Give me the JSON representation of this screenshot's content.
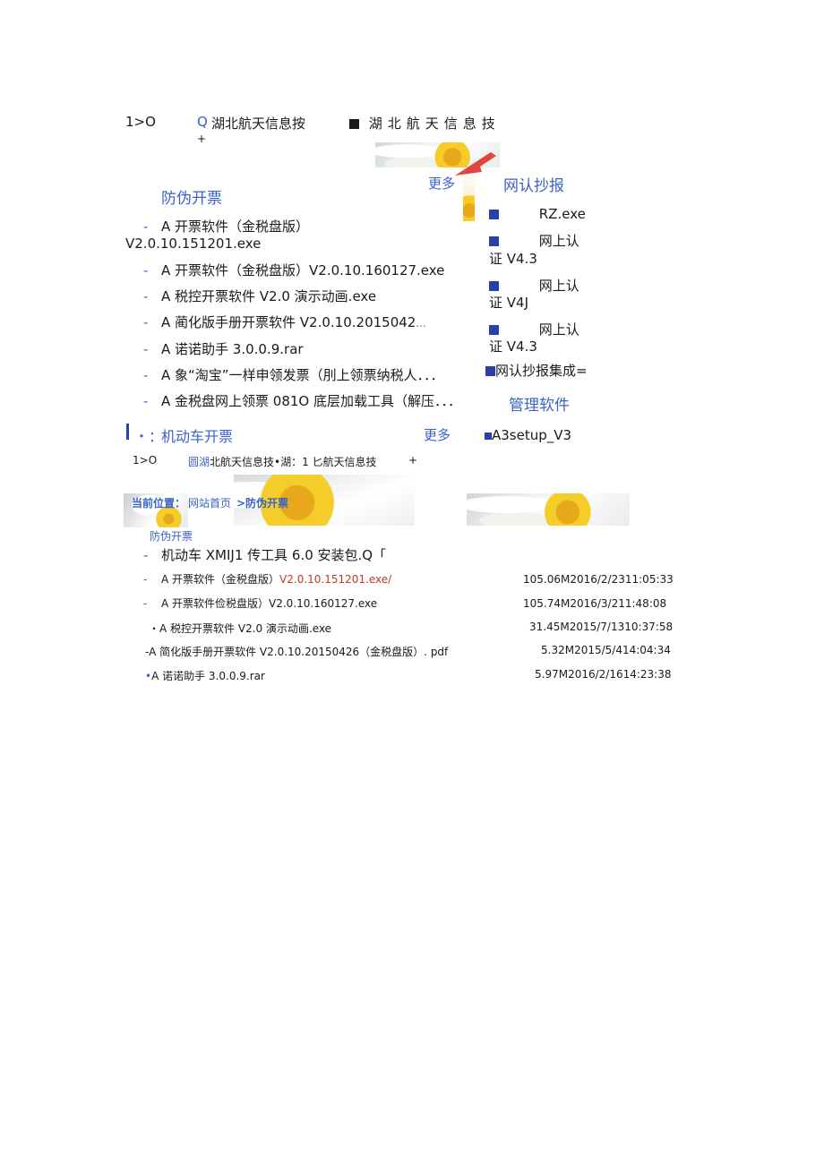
{
  "header": {
    "left_code": "1>O",
    "q_icon_text": "Q",
    "title_small": "湖北航天信息按",
    "plus": "+",
    "title_spaced": "湖北航天信息技"
  },
  "section1": {
    "title": "防伪开票",
    "more": "更多",
    "items": [
      "A 开票软件（金税盘版）",
      "V2.0.10.151201.exe",
      "A 开票软件（金税盘版）V2.0.10.160127.exe",
      "A 税控开票软件 V2.0 演示动画.exe",
      "A 蔺化版手册开票软件 V2.0.10.2015042",
      "...",
      "A 诺诺助手 3.0.0.9.rar",
      "A 象“淘宝”一样申领发票（刖上领票纳税人．．．",
      "A 金税盘网上领票 081O 底层加载工具（解压．．．"
    ],
    "dash": "-"
  },
  "sidebar": {
    "title": "网认抄报",
    "items": [
      {
        "l1": "RZ.exe",
        "l2": ""
      },
      {
        "l1": "网上认",
        "l2": "证 V4.3"
      },
      {
        "l1": "网上认",
        "l2": "证 V4J"
      },
      {
        "l1": "网上认",
        "l2": "证 V4.3"
      }
    ],
    "collection": "网认抄报集成=",
    "manage_title": "管理软件",
    "manage_item": "A3setup_V3"
  },
  "section2": {
    "prefix": "l・：",
    "title": "机动车开票",
    "more": "更多"
  },
  "breadcrumb_row": {
    "left_code": "1>O",
    "circle": "圆湖",
    "mid": "北航天信息技•湖：1 匕航天信息技",
    "plus": "+"
  },
  "location": {
    "label": "当前位置：",
    "home": "网站首页",
    "current": ">防伪开票",
    "sub": "防伪开票"
  },
  "files": {
    "first": "机动车 XMIJ1 传工具 6.0 安装包.Q「",
    "rows": [
      {
        "bullet": "-",
        "name_a": "A 开票软件（金税盘版）",
        "name_b": "V2.0.10.151201.exe/",
        "meta": "105.06M2016/2/2311:05:33"
      },
      {
        "bullet": "-",
        "name_a": "A 开票软件俭税盘版）V2.0.10.160127.exe",
        "name_b": "",
        "meta": "105.74M2016/3/211:48:08"
      },
      {
        "bullet": "・",
        "name_a": "A 税控开票软件 V2.0 演示动画.exe",
        "name_b": "",
        "meta": "31.45M2015/7/1310:37:58"
      },
      {
        "bullet": "-",
        "name_a": "A 简化版手册开票软件 V2.0.10.20150426（金税盘版）. pdf",
        "name_b": "",
        "meta": "5.32M2015/5/414:04:34"
      },
      {
        "bullet": "•",
        "name_a": "A 诺诺助手 3.0.0.9.rar",
        "name_b": "",
        "meta": "5.97M2016/2/1614:23:38"
      }
    ]
  },
  "colors": {
    "accent": "#3a63c7",
    "square": "#2b3fa8",
    "red": "#c0392b"
  }
}
